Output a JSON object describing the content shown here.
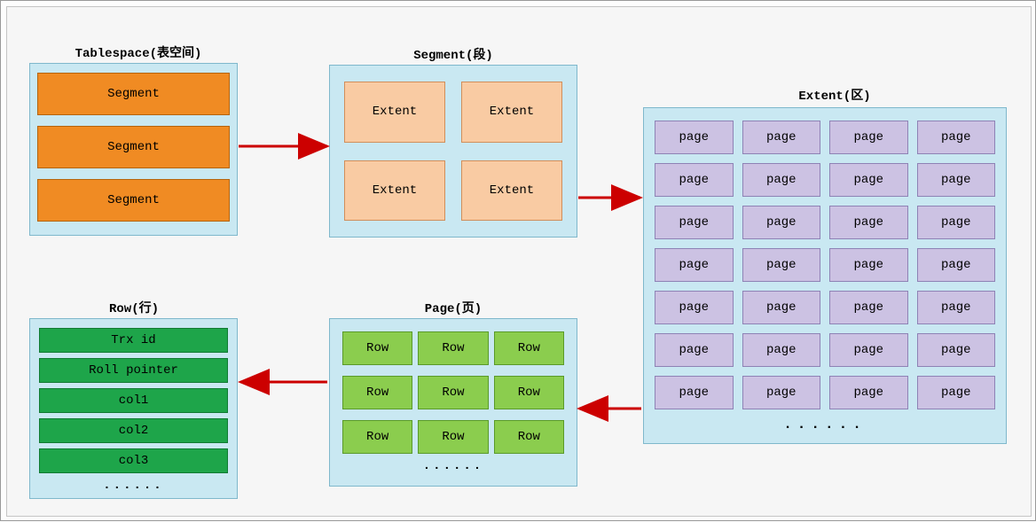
{
  "titles": {
    "tablespace": "Tablespace(表空间)",
    "segment": "Segment(段)",
    "extent": "Extent(区)",
    "page": "Page(页)",
    "row": "Row(行)"
  },
  "tablespace": {
    "items": [
      "Segment",
      "Segment",
      "Segment"
    ]
  },
  "segment": {
    "items": [
      "Extent",
      "Extent",
      "Extent",
      "Extent"
    ]
  },
  "extent": {
    "page_label": "page",
    "rows": 7,
    "cols": 4,
    "dots": "......"
  },
  "page": {
    "row_label": "Row",
    "rows": 3,
    "cols": 3,
    "dots": "......"
  },
  "row": {
    "fields": [
      "Trx id",
      "Roll pointer",
      "col1",
      "col2",
      "col3"
    ],
    "dots": "......"
  }
}
